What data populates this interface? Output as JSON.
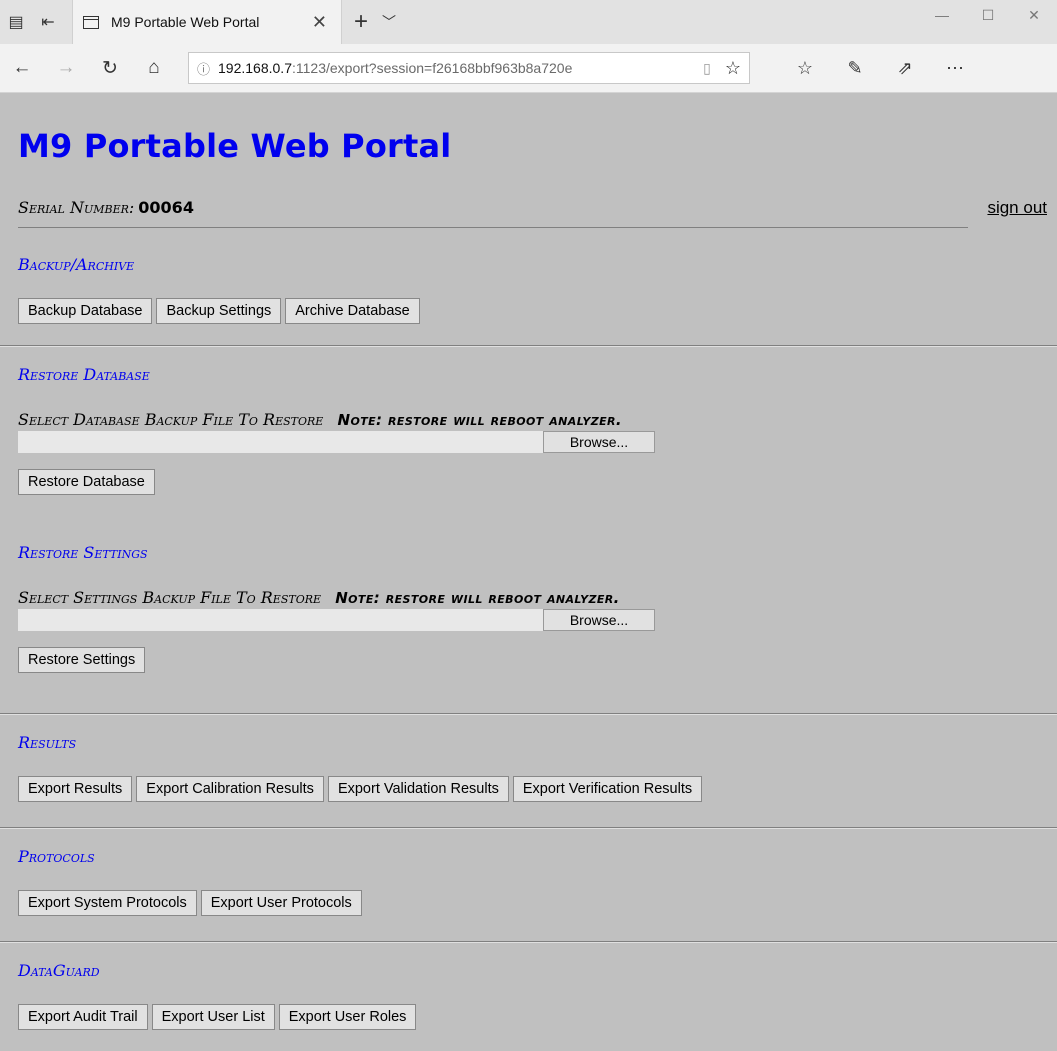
{
  "browser": {
    "tab_title": "M9 Portable Web Portal",
    "tab_close": "✕",
    "url_host": "192.168.0.7",
    "url_path": ":1123/export?session=f26168bbf963b8a720e"
  },
  "page": {
    "title": "M9 Portable Web Portal",
    "serial_label": "Serial Number:",
    "serial_value": "00064",
    "signout": "sign out"
  },
  "backup": {
    "title": "Backup/Archive",
    "buttons": [
      "Backup Database",
      "Backup Settings",
      "Archive Database"
    ]
  },
  "restore_db": {
    "title": "Restore Database",
    "label": "Select Database Backup File To Restore",
    "note": "Note: restore will reboot analyzer.",
    "browse": "Browse...",
    "button": "Restore Database"
  },
  "restore_settings": {
    "title": "Restore Settings",
    "label": "Select Settings Backup File To Restore",
    "note": "Note: restore will reboot analyzer.",
    "browse": "Browse...",
    "button": "Restore Settings"
  },
  "results": {
    "title": "Results",
    "buttons": [
      "Export Results",
      "Export Calibration Results",
      "Export Validation Results",
      "Export Verification Results"
    ]
  },
  "protocols": {
    "title": "Protocols",
    "buttons": [
      "Export System Protocols",
      "Export User Protocols"
    ]
  },
  "dataguard": {
    "title": "DataGuard",
    "buttons": [
      "Export Audit Trail",
      "Export User List",
      "Export User Roles"
    ]
  }
}
